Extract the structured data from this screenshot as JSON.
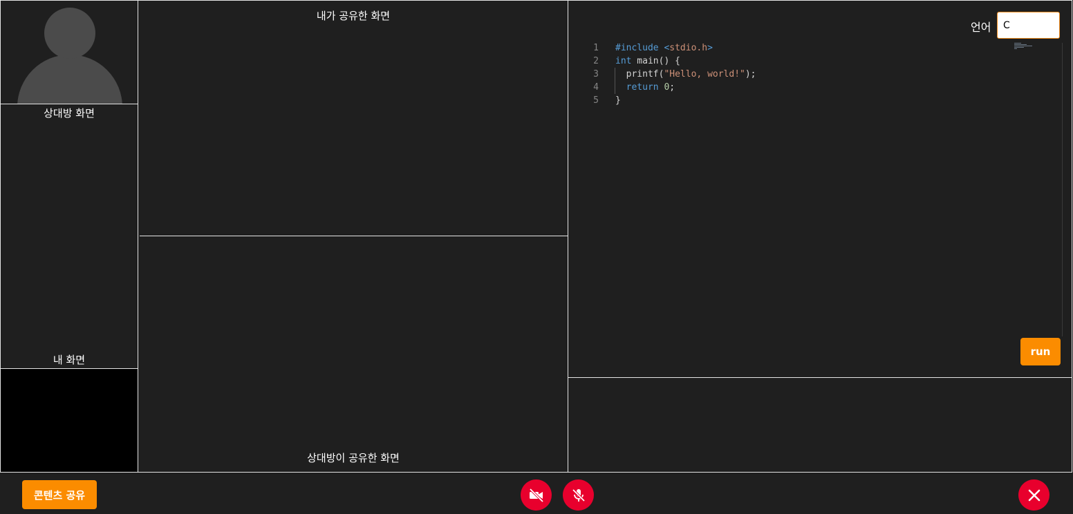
{
  "left_panel": {
    "peer_screen_label": "상대방 화면",
    "my_screen_label": "내 화면"
  },
  "center_panel": {
    "my_shared_label": "내가 공유한 화면",
    "peer_shared_label": "상대방이 공유한 화면"
  },
  "editor": {
    "language_label": "언어",
    "language_value": "C",
    "run_label": "run",
    "code_lines": [
      {
        "no": "1",
        "parts": [
          {
            "t": "#include <",
            "c": "kw"
          },
          {
            "t": "stdio.h",
            "c": "str"
          },
          {
            "t": ">",
            "c": "kw"
          }
        ]
      },
      {
        "no": "2",
        "parts": [
          {
            "t": "int",
            "c": "kw"
          },
          {
            "t": " main() {",
            "c": "txt"
          }
        ]
      },
      {
        "no": "3",
        "parts": [
          {
            "t": "  printf(",
            "c": "txt"
          },
          {
            "t": "\"Hello, world!\"",
            "c": "str"
          },
          {
            "t": ");",
            "c": "txt"
          }
        ]
      },
      {
        "no": "4",
        "parts": [
          {
            "t": "  ",
            "c": "txt"
          },
          {
            "t": "return",
            "c": "kw"
          },
          {
            "t": " ",
            "c": "txt"
          },
          {
            "t": "0",
            "c": "num"
          },
          {
            "t": ";",
            "c": "txt"
          }
        ]
      },
      {
        "no": "5",
        "parts": [
          {
            "t": "}",
            "c": "txt"
          }
        ]
      }
    ]
  },
  "footer": {
    "share_content_label": "콘텐츠 공유",
    "camera_icon": "video-off-icon",
    "mic_icon": "mic-off-icon",
    "end_icon": "close-icon"
  },
  "colors": {
    "background": "#1f1f1f",
    "accent_orange": "#fb8c00",
    "danger_red": "#e8002d"
  }
}
